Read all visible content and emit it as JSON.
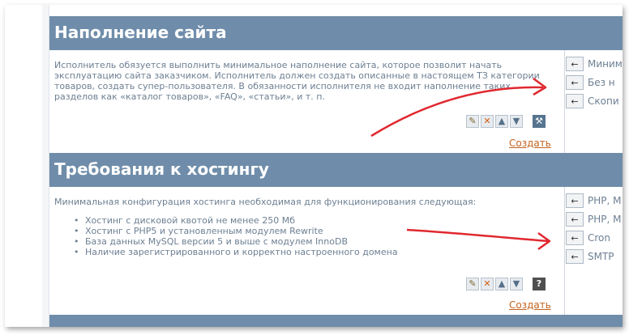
{
  "section1": {
    "title": "Наполнение сайта",
    "text": "Исполнитель обязуется выполнить минимальное наполнение сайта, которое позволит начать эксплуатацию сайта заказчиком. Исполнитель должен создать описанные в настоящем ТЗ категории товаров, создать супер-пользователя. В обязанности исполнителя не входит наполнение таких разделов как «каталог товаров», «FAQ», «статьи», и т. п.",
    "create_label": "Создать",
    "side_items": [
      "Миним",
      "Без н",
      "Скопи"
    ]
  },
  "section2": {
    "title": "Требования к хостингу",
    "text": "Минимальная конфигурация хостинга необходимая для функционирования следующая:",
    "list": [
      "Хостинг с дисковой квотой не менее 250 Мб",
      "Хостинг с PHP5 и установленным модулем Rewrite",
      "База данных MySQL версии 5 и выше с модулем InnoDB",
      "Наличие зарегистрированного и корректно настроенного домена"
    ],
    "create_label": "Создать",
    "side_items": [
      "PHP, M",
      "PHP, M",
      "Cron",
      "SMTP"
    ]
  },
  "icons": {
    "edit": "pencil-icon",
    "delete": "delete-x-icon",
    "up": "arrow-up-icon",
    "down": "arrow-down-icon",
    "tool": "hammer-icon",
    "help": "question-icon",
    "insert": "arrow-left-icon"
  },
  "colors": {
    "header_band": "#6f8daa",
    "text": "#6d7f92",
    "link": "#c3631d",
    "annotation_arrow": "#e0282f"
  }
}
